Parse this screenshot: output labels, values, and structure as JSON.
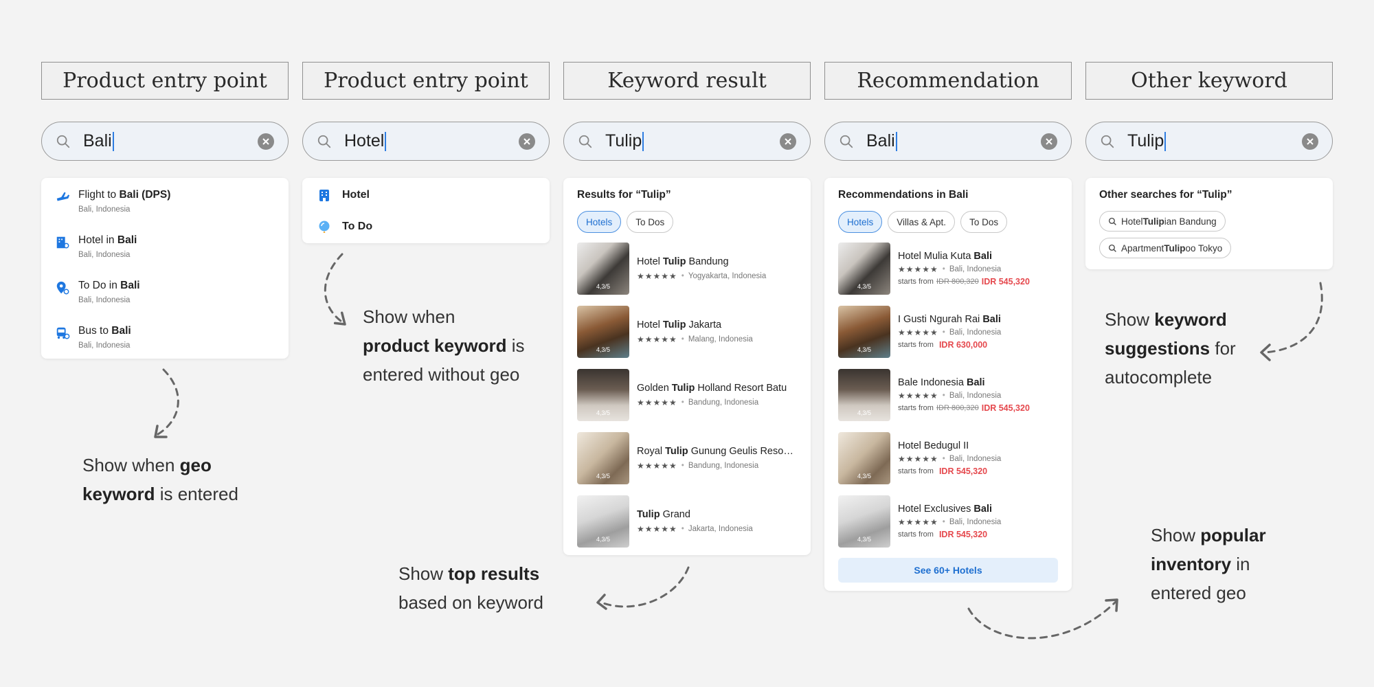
{
  "columns": [
    {
      "heading": "Product entry point",
      "query": "Bali"
    },
    {
      "heading": "Product entry point",
      "query": "Hotel"
    },
    {
      "heading": "Keyword result",
      "query": "Tulip"
    },
    {
      "heading": "Recommendation",
      "query": "Bali"
    },
    {
      "heading": "Other keyword",
      "query": "Tulip"
    }
  ],
  "col1": {
    "items": [
      {
        "icon": "flight-icon",
        "pre": "Flight to ",
        "bold": "Bali (DPS)",
        "sub": "Bali, Indonesia"
      },
      {
        "icon": "hotel-icon",
        "pre": "Hotel in ",
        "bold": "Bali",
        "sub": "Bali, Indonesia"
      },
      {
        "icon": "location-pin-icon",
        "pre": "To Do in ",
        "bold": "Bali",
        "sub": "Bali, Indonesia"
      },
      {
        "icon": "bus-icon",
        "pre": "Bus to ",
        "bold": "Bali",
        "sub": "Bali, Indonesia"
      }
    ]
  },
  "col2": {
    "items": [
      {
        "icon": "hotel-building-icon",
        "label": "Hotel"
      },
      {
        "icon": "todo-balloon-icon",
        "label": "To Do"
      }
    ]
  },
  "col3": {
    "title": "Results for “Tulip”",
    "chips": [
      "Hotels",
      "To Dos"
    ],
    "results": [
      {
        "pre": "Hotel ",
        "bold": "Tulip",
        "post": " Bandung",
        "rating": "4,3",
        "scale": "/5",
        "stars": "★★★★★",
        "loc": "Yogyakarta, Indonesia"
      },
      {
        "pre": "Hotel ",
        "bold": "Tulip",
        "post": " Jakarta",
        "rating": "4,3",
        "scale": "/5",
        "stars": "★★★★★",
        "loc": "Malang, Indonesia"
      },
      {
        "pre": "Golden ",
        "bold": "Tulip",
        "post": " Holland Resort Batu",
        "rating": "4,3",
        "scale": "/5",
        "stars": "★★★★★",
        "loc": "Bandung, Indonesia"
      },
      {
        "pre": "Royal ",
        "bold": "Tulip",
        "post": " Gunung Geulis Resort...",
        "rating": "4,3",
        "scale": "/5",
        "stars": "★★★★★",
        "loc": "Bandung, Indonesia"
      },
      {
        "pre": "",
        "bold": "Tulip",
        "post": " Grand",
        "rating": "4,3",
        "scale": "/5",
        "stars": "★★★★★",
        "loc": "Jakarta, Indonesia"
      }
    ]
  },
  "col4": {
    "title": "Recommendations in Bali",
    "chips": [
      "Hotels",
      "Villas & Apt.",
      "To Dos"
    ],
    "results": [
      {
        "pre": "Hotel Mulia Kuta ",
        "bold": "Bali",
        "rating": "4,3",
        "scale": "/5",
        "stars": "★★★★★",
        "loc": "Bali, Indonesia",
        "from": "starts from",
        "old": "IDR 800,320",
        "price": "IDR 545,320"
      },
      {
        "pre": "I Gusti Ngurah Rai ",
        "bold": "Bali",
        "rating": "4,3",
        "scale": "/5",
        "stars": "★★★★★",
        "loc": "Bali, Indonesia",
        "from": "starts from",
        "old": "",
        "price": "IDR 630,000"
      },
      {
        "pre": "Bale Indonesia ",
        "bold": "Bali",
        "rating": "4,3",
        "scale": "/5",
        "stars": "★★★★★",
        "loc": "Bali, Indonesia",
        "from": "starts from",
        "old": "IDR 800,320",
        "price": "IDR 545,320"
      },
      {
        "pre": "Hotel Bedugul II",
        "bold": "",
        "rating": "4,3",
        "scale": "/5",
        "stars": "★★★★★",
        "loc": "Bali, Indonesia",
        "from": "starts from",
        "old": "",
        "price": "IDR 545,320"
      },
      {
        "pre": "Hotel Exclusives ",
        "bold": "Bali",
        "rating": "4,3",
        "scale": "/5",
        "stars": "★★★★★",
        "loc": "Bali, Indonesia",
        "from": "starts from",
        "old": "",
        "price": "IDR 545,320"
      }
    ],
    "button": "See 60+ Hotels"
  },
  "col5": {
    "title": "Other searches for “Tulip”",
    "chips": [
      {
        "pre": "Hotel ",
        "bold": "Tulip",
        "post": "ian Bandung"
      },
      {
        "pre": "Apartment ",
        "bold": "Tulip",
        "post": "oo Tokyo"
      }
    ]
  },
  "notes": {
    "n1": {
      "a": "Show when ",
      "b": "geo",
      "c": "keyword",
      "d": " is entered"
    },
    "n2": {
      "a": "Show when",
      "b": "product keyword",
      "c": " is",
      "d": "entered without geo"
    },
    "n3": {
      "a": "Show ",
      "b": "top results",
      "c": "based on keyword"
    },
    "n4": {
      "a": "Show ",
      "b": "keyword",
      "c": "suggestions",
      "d": " for",
      "e": "autocomplete"
    },
    "n5": {
      "a": "Show ",
      "b": "popular",
      "c": "inventory",
      "d": " in",
      "e": "entered geo"
    }
  },
  "colors": {
    "accent": "#2e7de1",
    "price": "#e5484d",
    "chip_active_bg": "#e3effc"
  }
}
